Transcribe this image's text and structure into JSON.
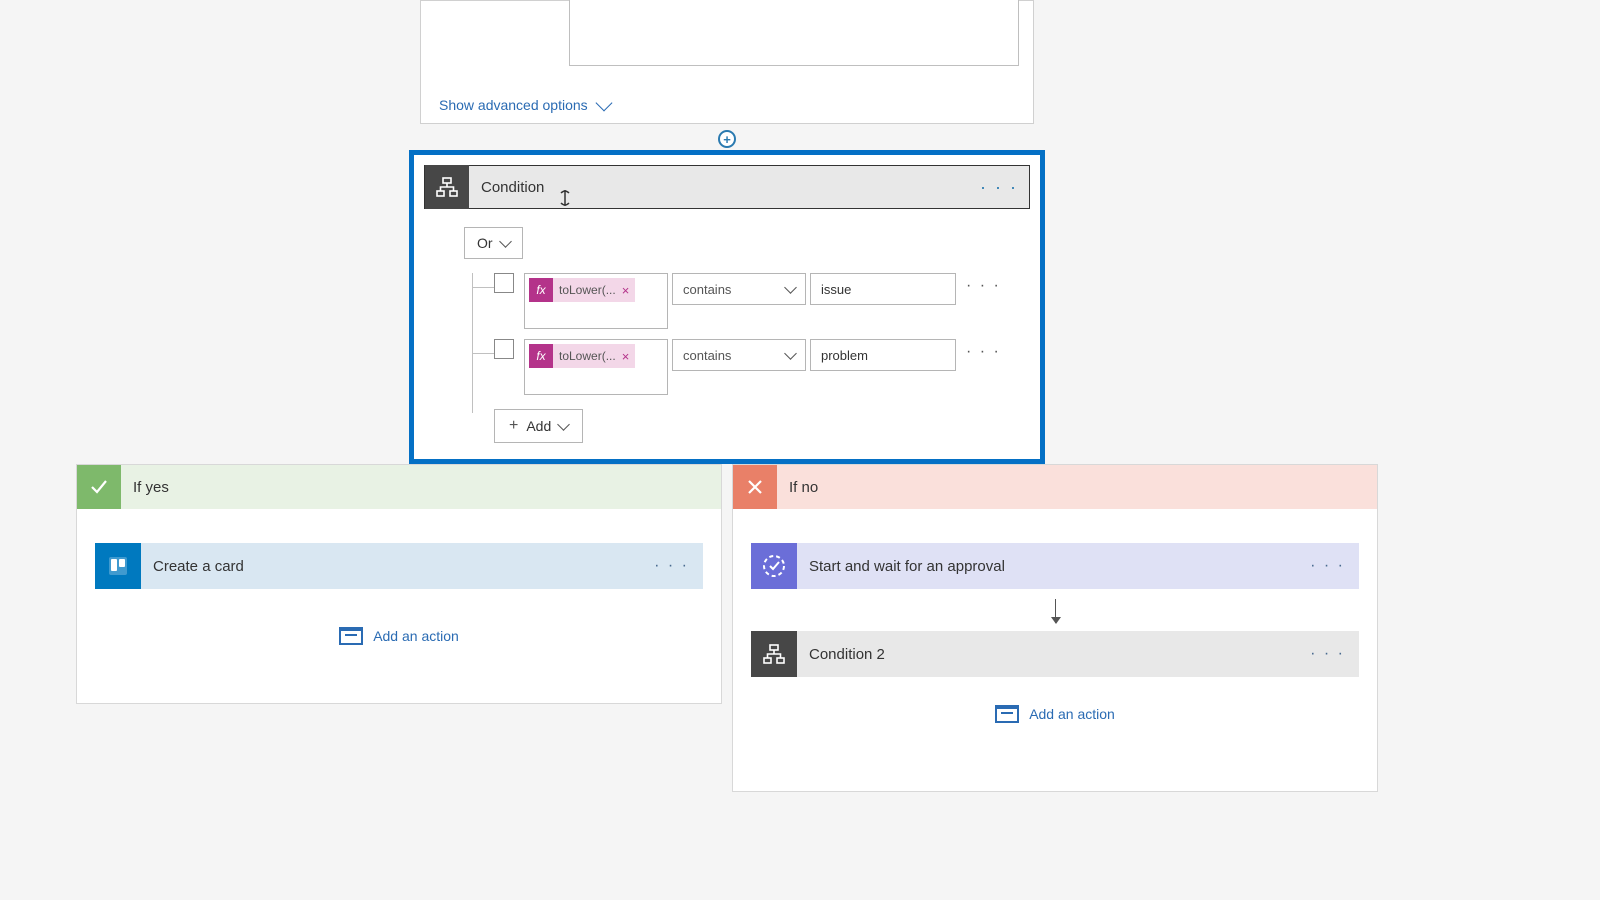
{
  "topCard": {
    "advancedOptions": "Show advanced options"
  },
  "condition": {
    "title": "Condition",
    "groupOperator": "Or",
    "addLabel": "Add",
    "rows": [
      {
        "fxLabel": "toLower(...",
        "operator": "contains",
        "value": "issue"
      },
      {
        "fxLabel": "toLower(...",
        "operator": "contains",
        "value": "problem"
      }
    ]
  },
  "branches": {
    "yes": {
      "label": "If yes",
      "actions": [
        {
          "label": "Create a card"
        }
      ],
      "addActionLabel": "Add an action"
    },
    "no": {
      "label": "If no",
      "actions": [
        {
          "label": "Start and wait for an approval"
        },
        {
          "label": "Condition 2"
        }
      ],
      "addActionLabel": "Add an action"
    }
  }
}
